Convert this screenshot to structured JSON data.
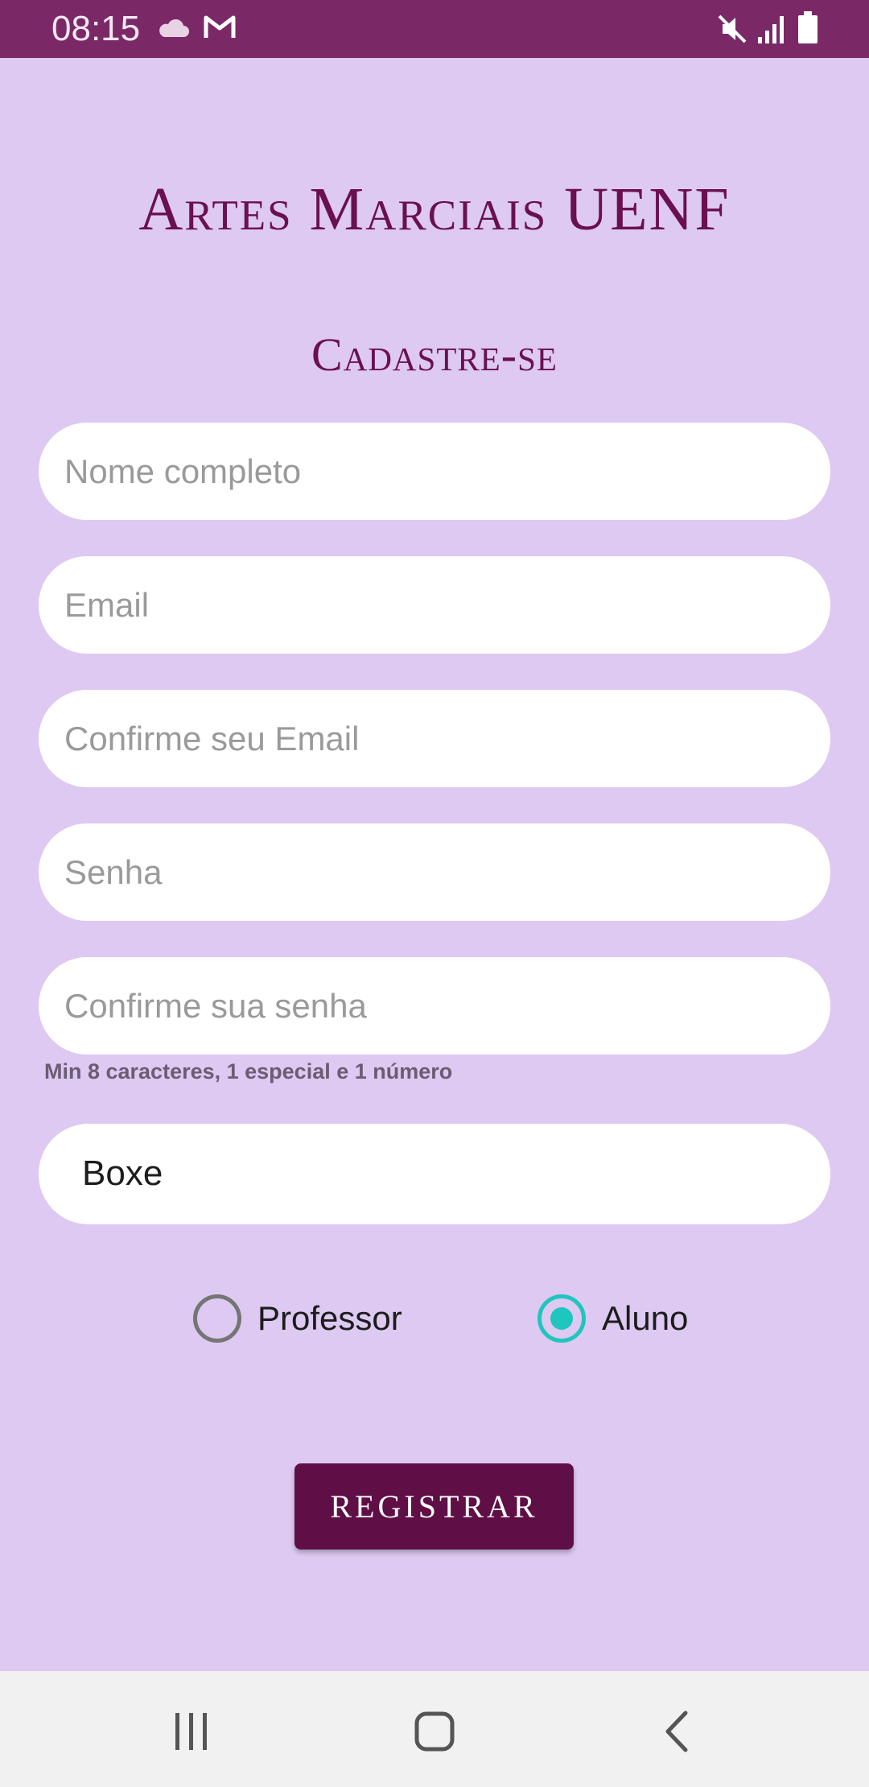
{
  "status_bar": {
    "time": "08:15",
    "icons": [
      "cloud-icon",
      "mail-icon",
      "mute-icon",
      "signal-icon",
      "battery-icon"
    ],
    "background": "#7b2966"
  },
  "header": {
    "title": "Artes Marciais UENF",
    "subtitle": "Cadastre-se"
  },
  "form": {
    "name_placeholder": "Nome completo",
    "email_placeholder": "Email",
    "confirm_email_placeholder": "Confirme seu Email",
    "password_placeholder": "Senha",
    "confirm_password_placeholder": "Confirme sua senha",
    "password_hint": "Min 8 caracteres, 1 especial e 1 número",
    "modality_selected": "Boxe",
    "role_options": [
      {
        "label": "Professor",
        "checked": false
      },
      {
        "label": "Aluno",
        "checked": true
      }
    ],
    "register_label": "REGISTRAR"
  },
  "nav_bar": {
    "icons": [
      "recents-icon",
      "home-icon",
      "back-icon"
    ]
  },
  "colors": {
    "background": "#ddc9f1",
    "accent": "#6a1051",
    "button": "#5f0e46",
    "radio_checked": "#1fc6bd"
  }
}
